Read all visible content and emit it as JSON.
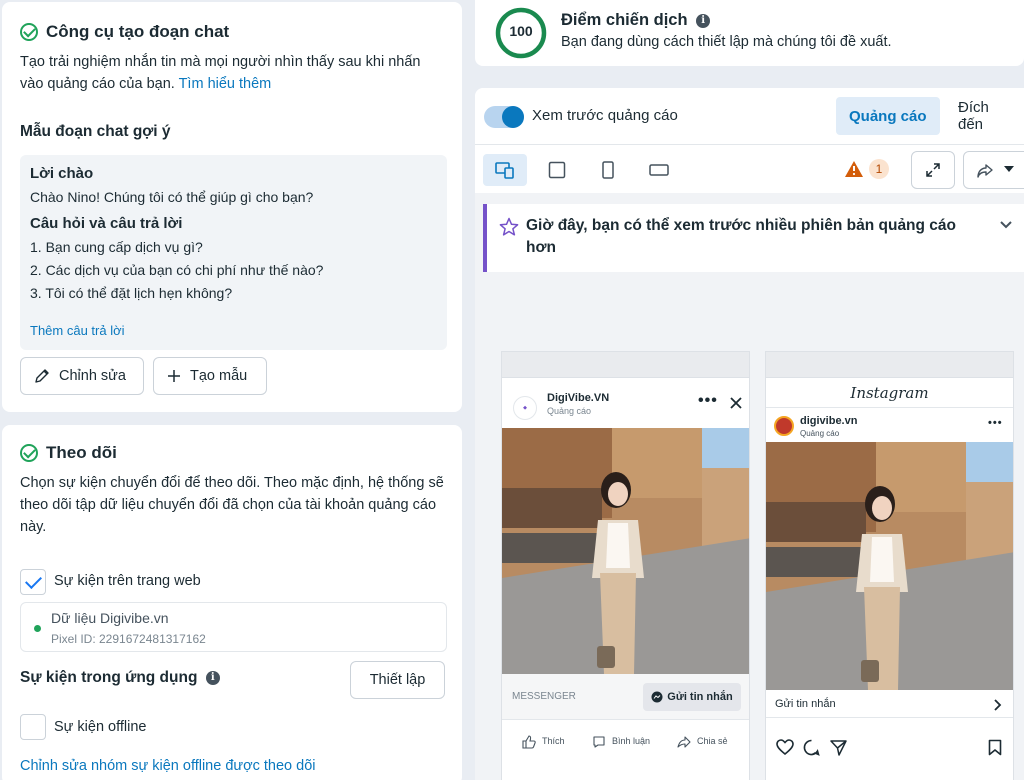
{
  "chat_builder": {
    "title": "Công cụ tạo đoạn chat",
    "description": "Tạo trải nghiệm nhắn tin mà mọi người nhìn thấy sau khi nhấn vào quảng cáo của bạn.",
    "learn_more": "Tìm hiểu thêm",
    "templates_title": "Mẫu đoạn chat gợi ý",
    "greeting_title": "Lời chào",
    "greeting_text": "Chào Nino! Chúng tôi có thể giúp gì cho bạn?",
    "qa_title": "Câu hỏi và câu trả lời",
    "questions": [
      "1. Bạn cung cấp dịch vụ gì?",
      "2. Các dịch vụ của bạn có chi phí như thế nào?",
      "3. Tôi có thể đặt lịch hẹn không?"
    ],
    "add_answer": "Thêm câu trả lời",
    "edit_label": "Chỉnh sửa",
    "create_template_label": "Tạo mẫu"
  },
  "tracking": {
    "title": "Theo dõi",
    "description": "Chọn sự kiện chuyển đổi để theo dõi. Theo mặc định, hệ thống sẽ theo dõi tập dữ liệu chuyển đổi đã chọn của tài khoản quảng cáo này.",
    "web_events_label": "Sự kiện trên trang web",
    "web_events_checked": true,
    "dataset_name": "Dữ liệu Digivibe.vn",
    "pixel_id": "Pixel ID: 2291672481317162",
    "app_events_label": "Sự kiện trong ứng dụng",
    "setup_label": "Thiết lập",
    "offline_events_label": "Sự kiện offline",
    "offline_events_checked": false,
    "offline_link": "Chỉnh sửa nhóm sự kiện offline được theo dõi"
  },
  "score": {
    "value": "100",
    "title": "Điểm chiến dịch",
    "subtitle": "Bạn đang dùng cách thiết lập mà chúng tôi đề xuất."
  },
  "preview": {
    "toggle_label": "Xem trước quảng cáo",
    "tab_ads": "Quảng cáo",
    "tab_destination": "Đích đến",
    "warning_count": "1",
    "banner_text": "Giờ đây, bạn có thể xem trước nhiều phiên bản quảng cáo hơn",
    "fb_card": {
      "page_name": "DigiVibe.VN",
      "sponsored": "Quảng cáo",
      "cta_platform": "MESSENGER",
      "cta_button": "Gửi tin nhắn",
      "actions": [
        "Thích",
        "Bình luận",
        "Chia sẻ"
      ]
    },
    "ig_card": {
      "logo": "Instagram",
      "account": "digivibe.vn",
      "sponsored": "Quảng cáo",
      "cta": "Gửi tin nhắn"
    }
  },
  "colors": {
    "accent": "#0a78be",
    "success": "#20a35a",
    "banner_border": "#7552c9",
    "warning": "#d35d0a"
  }
}
